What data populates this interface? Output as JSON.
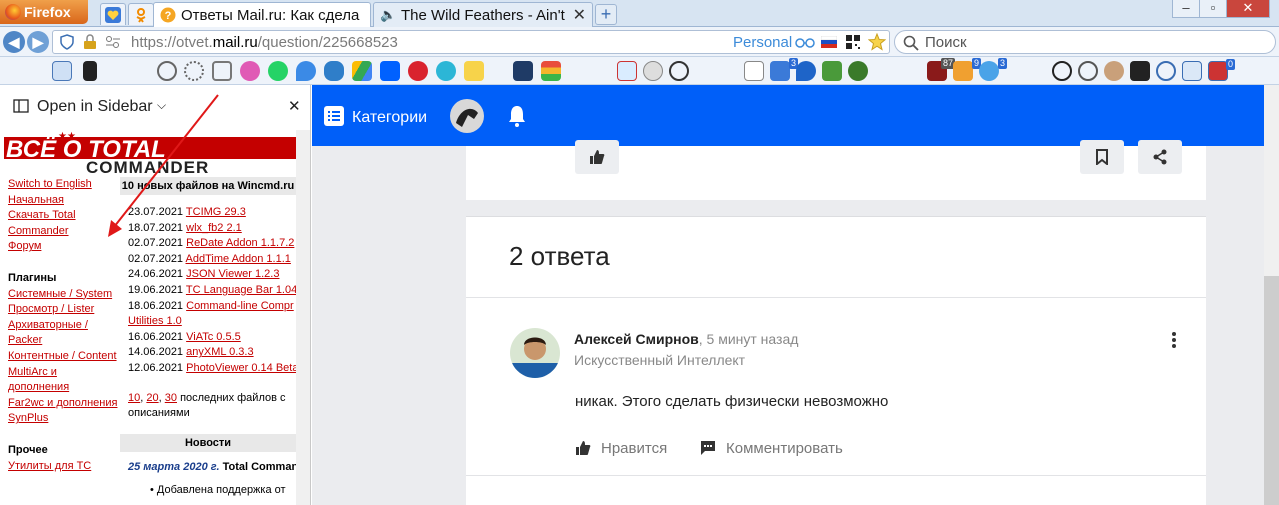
{
  "browser": {
    "app_button": "Firefox",
    "tabs": [
      {
        "title": "Ответы Mail.ru: Как сдела",
        "active": true
      },
      {
        "title": "The Wild Feathers - Ain't",
        "active": false
      }
    ],
    "url": {
      "prefix": "https://otvet.",
      "domain": "mail.ru",
      "path": "/question/225668523"
    },
    "personal_label": "Personal",
    "search_placeholder": "Поиск",
    "toolbar_badges": [
      "3",
      "87",
      "9",
      "3",
      "0"
    ],
    "window_buttons": [
      "–",
      "▫",
      "✕"
    ]
  },
  "sidebar": {
    "header": "Open in Sidebar",
    "logo_top": "ВСЁ О TOTAL",
    "logo_bottom": "COMMANDER",
    "nav_links": [
      "Switch to English",
      "Начальная",
      "Скачать Total Commander",
      "Форум"
    ],
    "plugins_title": "Плагины",
    "plugin_links": [
      "Системные / System",
      "Просмотр / Lister",
      "Архиваторные / Packer",
      "Контентные / Content",
      "MultiArc и дополнения",
      "Far2wc и дополнения",
      "SynPlus"
    ],
    "other_title": "Прочее",
    "other_links": [
      "Утилиты для TC"
    ],
    "new_files_title": "10 новых файлов на Wincmd.ru",
    "new_files": [
      {
        "date": "23.07.2021",
        "name": "TCIMG 29.3"
      },
      {
        "date": "18.07.2021",
        "name": "wlx_fb2 2.1"
      },
      {
        "date": "02.07.2021",
        "name": "ReDate Addon 1.1.7.2"
      },
      {
        "date": "02.07.2021",
        "name": "AddTime Addon 1.1.1"
      },
      {
        "date": "24.06.2021",
        "name": "JSON Viewer 1.2.3"
      },
      {
        "date": "19.06.2021",
        "name": "TC Language Bar 1.04"
      },
      {
        "date": "18.06.2021",
        "name": "Command-line Compr"
      },
      {
        "date": "",
        "name": "Utilities 1.0"
      },
      {
        "date": "16.06.2021",
        "name": "ViATc 0.5.5"
      },
      {
        "date": "14.06.2021",
        "name": "anyXML 0.3.3"
      },
      {
        "date": "12.06.2021",
        "name": "PhotoViewer 0.14 Beta"
      }
    ],
    "last_files": {
      "n1": "10",
      "n2": "20",
      "n3": "30",
      "text": "последних файлов с описаниями"
    },
    "news_title": "Новости",
    "news_date": "25 марта 2020 г.",
    "news_headline": "Total Commander",
    "news_item": "Добавлена поддержка от"
  },
  "page": {
    "categories": "Категории",
    "answers_count": "2 ответа",
    "answer": {
      "author": "Алексей Смирнов",
      "time": ", 5 минут назад",
      "rank": "Искусственный Интеллект",
      "text": "никак. Этого сделать физически невозможно",
      "like": "Нравится",
      "comment": "Комментировать"
    }
  },
  "colors": {
    "mail_blue": "#005ff9",
    "tc_red": "#c40000"
  }
}
